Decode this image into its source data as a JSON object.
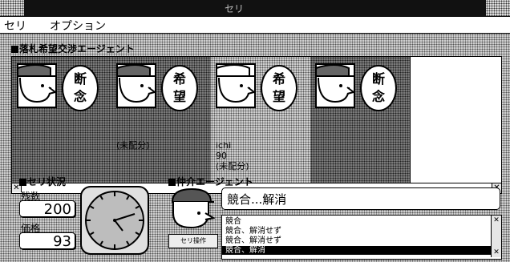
{
  "window": {
    "title": "セリ"
  },
  "menu": {
    "items": [
      "セリ",
      "オプション"
    ]
  },
  "agents_section": {
    "title": "落札希望交渉エージェント"
  },
  "agents": [
    {
      "status": "断\n念",
      "lines": [
        "",
        "",
        ""
      ],
      "style": "dark"
    },
    {
      "status": "希\n望",
      "lines": [
        "",
        "",
        "(未配分)"
      ],
      "style": "dark"
    },
    {
      "status": "希\n望",
      "lines": [
        "ichi",
        "90",
        "(未配分)"
      ],
      "style": "light"
    },
    {
      "status": "断\n念",
      "lines": [
        "",
        "",
        ""
      ],
      "style": "dark"
    }
  ],
  "auction": {
    "title": "セリ状況",
    "remaining_label": "残数",
    "remaining_value": "200",
    "price_label": "価格",
    "price_value": "93"
  },
  "broker": {
    "title": "仲介エージェント",
    "message": "競合...解消",
    "button": "セリ操作",
    "log": [
      "競合",
      "競合、解消せず",
      "競合、解消せず",
      "競合、解消"
    ],
    "selected_log_index": 3
  }
}
